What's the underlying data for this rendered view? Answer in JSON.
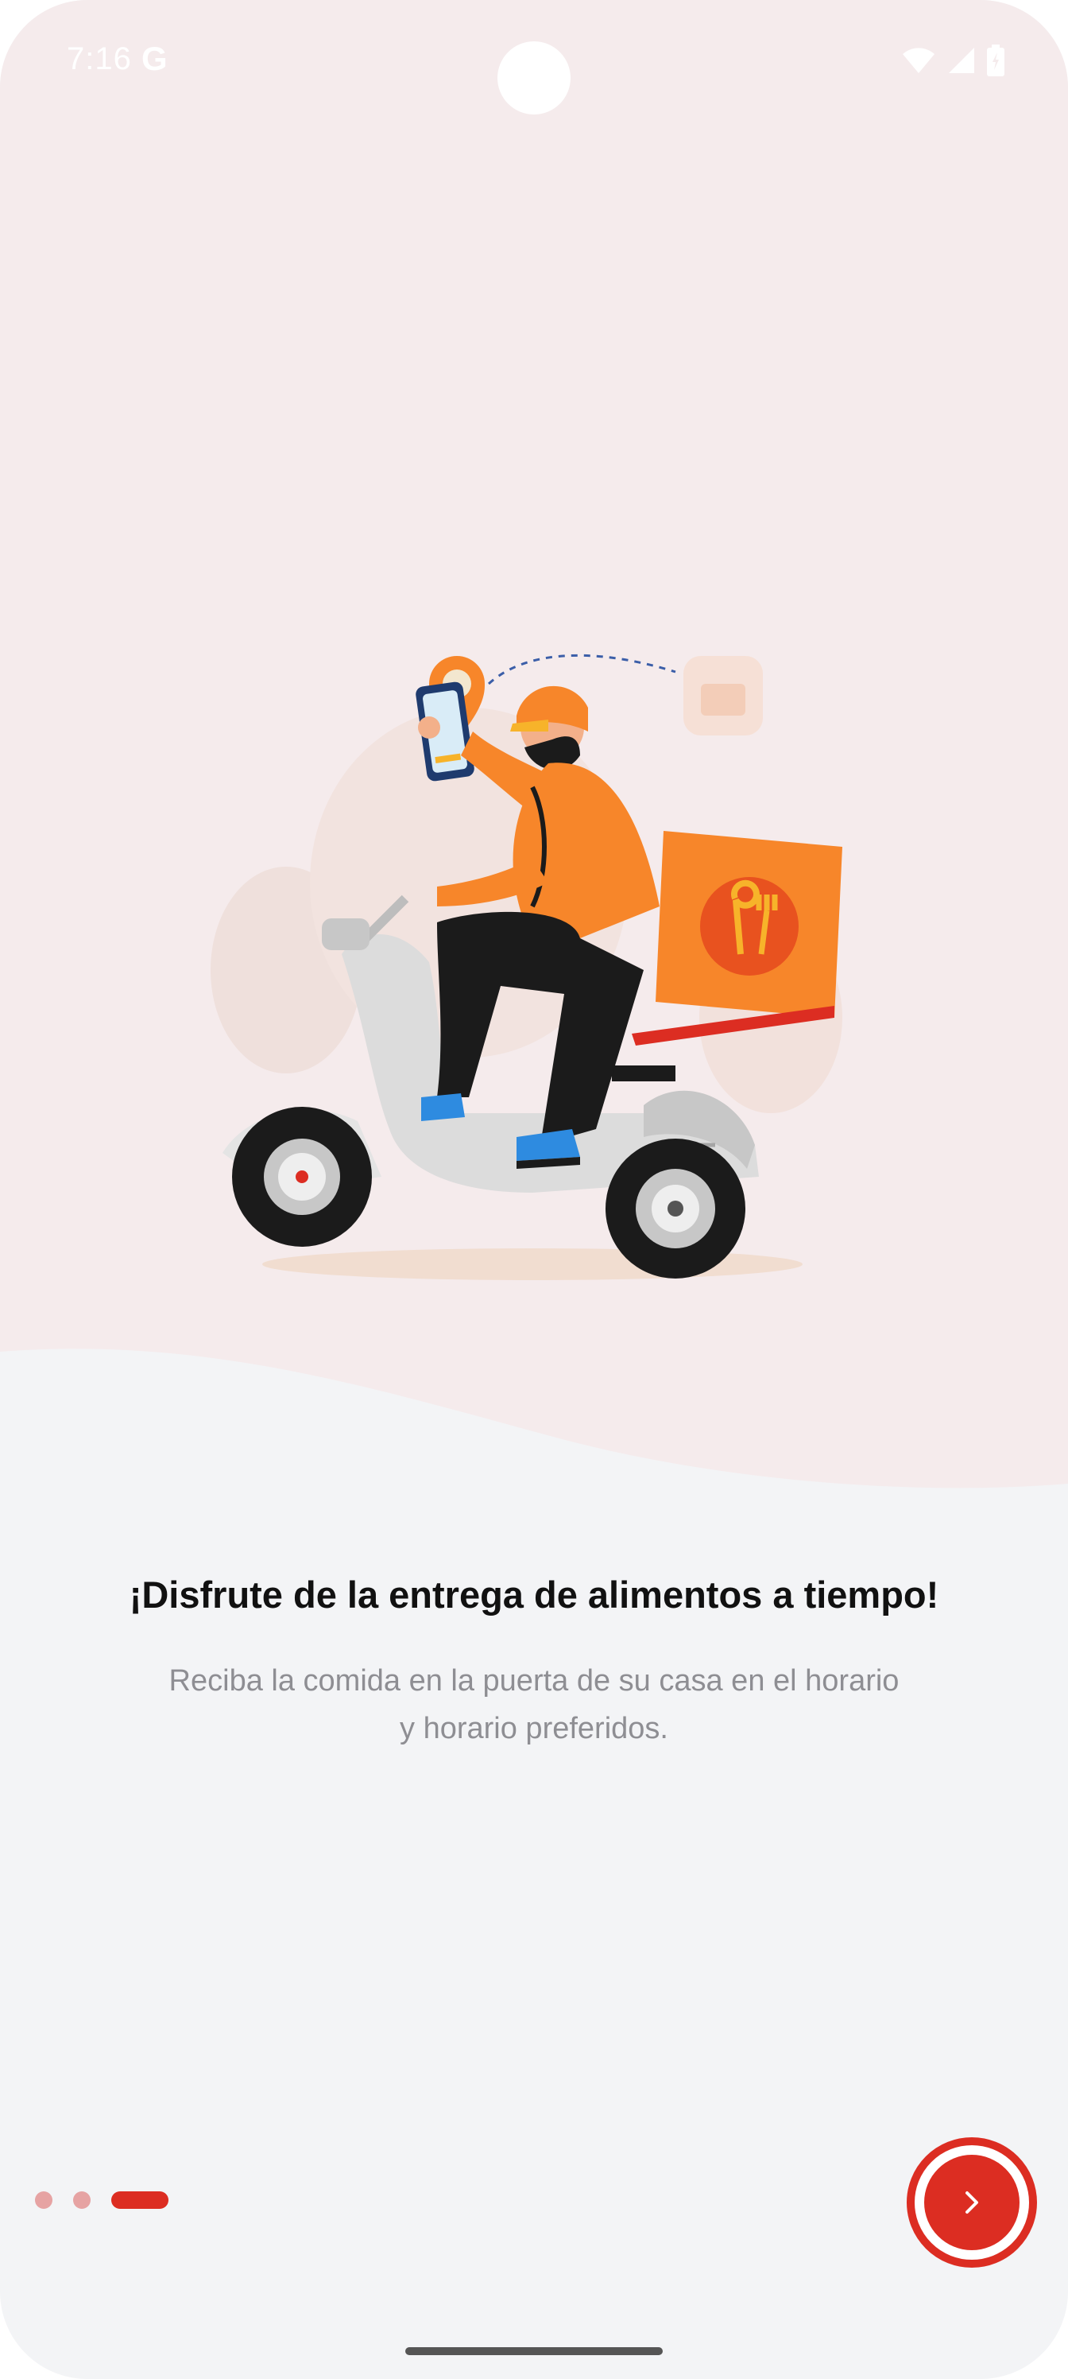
{
  "status_bar": {
    "time": "7:16",
    "google_glyph": "G",
    "icons": [
      "wifi-icon",
      "signal-icon",
      "battery-icon"
    ]
  },
  "onboarding": {
    "title": "¡Disfrute de la entrega de alimentos a tiempo!",
    "subtitle": "Reciba la comida en la puerta de su casa en el horario y horario preferidos.",
    "illustration": "delivery-scooter-illustration",
    "page_indicator": {
      "total": 3,
      "current": 3
    }
  },
  "colors": {
    "accent": "#dc2d22",
    "hero_background": "#f5ebec",
    "page_background": "#f3f4f6",
    "inactive_dot": "#e6a3a3",
    "rider_orange": "#f7862a"
  },
  "next_button": {
    "icon": "chevron-right-icon"
  }
}
